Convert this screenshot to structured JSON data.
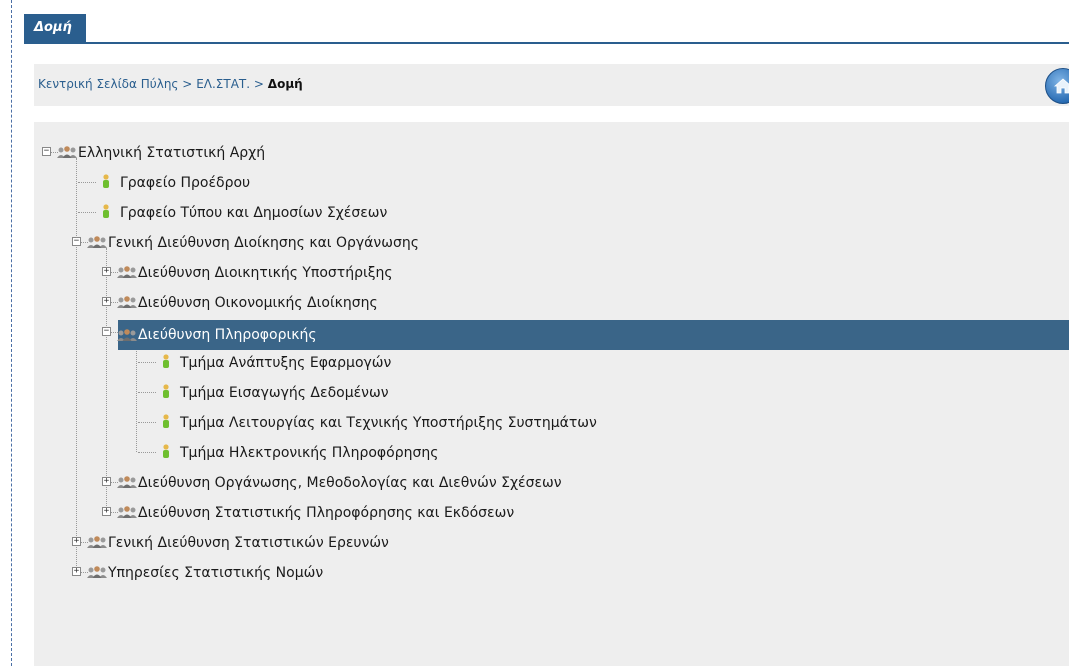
{
  "tab": {
    "title": "Δομή"
  },
  "breadcrumb": {
    "items": [
      "Κεντρική Σελίδα Πύλης",
      "ΕΛ.ΣΤΑΤ."
    ],
    "separator": ">",
    "current": "Δομή",
    "home_icon": "home-icon"
  },
  "colors": {
    "accent": "#2a5e8e",
    "panel": "#eeeeee",
    "selected_row": "#3a6588"
  },
  "tree": [
    {
      "label": "Ελληνική Στατιστική Αρχή",
      "level": 0,
      "type": "group",
      "state": "expanded"
    },
    {
      "label": "Γραφείο Προέδρου",
      "level": 1,
      "type": "person"
    },
    {
      "label": "Γραφείο Τύπου και Δημοσίων Σχέσεων",
      "level": 1,
      "type": "person"
    },
    {
      "label": "Γενική Διεύθυνση Διοίκησης και Οργάνωσης",
      "level": 1,
      "type": "group",
      "state": "expanded"
    },
    {
      "label": "Διεύθυνση Διοικητικής Υποστήριξης",
      "level": 2,
      "type": "group",
      "state": "collapsed"
    },
    {
      "label": "Διεύθυνση Οικονομικής Διοίκησης",
      "level": 2,
      "type": "group",
      "state": "collapsed"
    },
    {
      "label": "Διεύθυνση Πληροφορικής",
      "level": 2,
      "type": "group",
      "state": "expanded",
      "selected": true
    },
    {
      "label": "Τμήμα Ανάπτυξης Εφαρμογών",
      "level": 3,
      "type": "person"
    },
    {
      "label": "Τμήμα Εισαγωγής Δεδομένων",
      "level": 3,
      "type": "person"
    },
    {
      "label": "Τμήμα Λειτουργίας και Τεχνικής Υποστήριξης Συστημάτων",
      "level": 3,
      "type": "person"
    },
    {
      "label": "Τμήμα Ηλεκτρονικής Πληροφόρησης",
      "level": 3,
      "type": "person"
    },
    {
      "label": "Διεύθυνση Οργάνωσης, Μεθοδολογίας και Διεθνών Σχέσεων",
      "level": 2,
      "type": "group",
      "state": "collapsed"
    },
    {
      "label": "Διεύθυνση Στατιστικής Πληροφόρησης και Εκδόσεων",
      "level": 2,
      "type": "group",
      "state": "collapsed"
    },
    {
      "label": "Γενική Διεύθυνση Στατιστικών Ερευνών",
      "level": 1,
      "type": "group",
      "state": "collapsed"
    },
    {
      "label": "Υπηρεσίες Στατιστικής Νομών",
      "level": 1,
      "type": "group",
      "state": "collapsed"
    }
  ]
}
